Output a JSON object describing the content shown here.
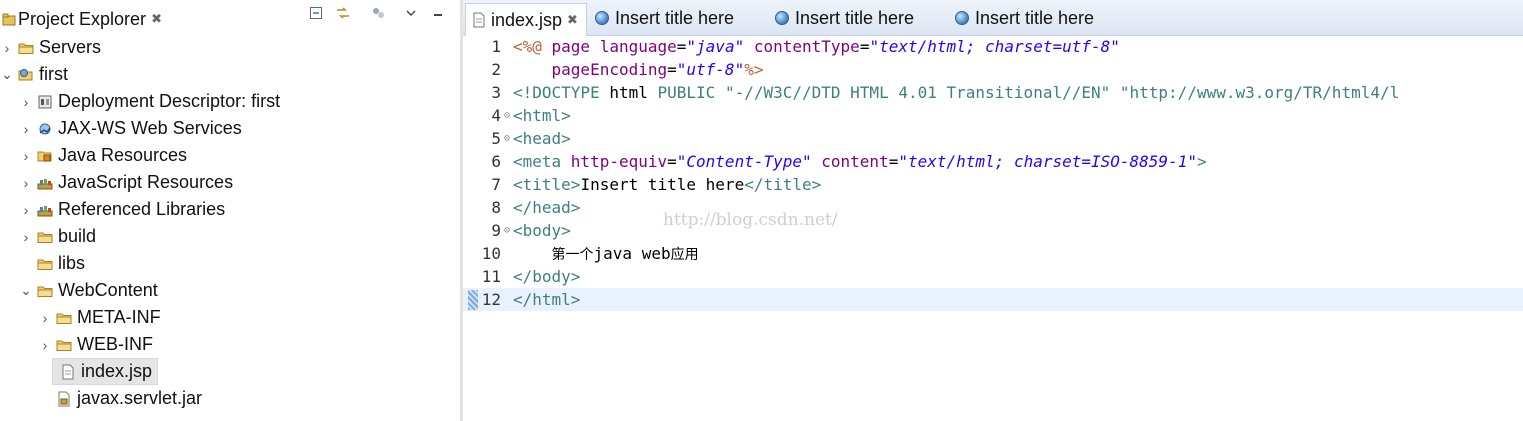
{
  "explorer": {
    "title": "Project Explorer",
    "close": "✖",
    "tree": [
      {
        "label": "Servers",
        "arrow": "›",
        "icon": "folder-icon",
        "indent": 0
      },
      {
        "label": "first",
        "arrow": "⌄",
        "icon": "web-project-icon",
        "indent": 0
      },
      {
        "label": "Deployment Descriptor: first",
        "arrow": "›",
        "icon": "deployment-descriptor-icon",
        "indent": 1
      },
      {
        "label": "JAX-WS Web Services",
        "arrow": "›",
        "icon": "web-services-icon",
        "indent": 1
      },
      {
        "label": "Java Resources",
        "arrow": "›",
        "icon": "java-resources-icon",
        "indent": 1
      },
      {
        "label": "JavaScript Resources",
        "arrow": "›",
        "icon": "library-icon",
        "indent": 1
      },
      {
        "label": "Referenced Libraries",
        "arrow": "›",
        "icon": "library-icon",
        "indent": 1
      },
      {
        "label": "build",
        "arrow": "›",
        "icon": "folder-icon",
        "indent": 1
      },
      {
        "label": "libs",
        "arrow": "",
        "icon": "folder-icon",
        "indent": 1
      },
      {
        "label": "WebContent",
        "arrow": "⌄",
        "icon": "folder-icon",
        "indent": 1
      },
      {
        "label": "META-INF",
        "arrow": "›",
        "icon": "folder-icon",
        "indent": 2
      },
      {
        "label": "WEB-INF",
        "arrow": "›",
        "icon": "folder-icon",
        "indent": 2
      },
      {
        "label": "index.jsp",
        "arrow": "",
        "icon": "jsp-file-icon",
        "indent": 2,
        "selected": true
      },
      {
        "label": "javax.servlet.jar",
        "arrow": "",
        "icon": "jar-file-icon",
        "indent": 2
      }
    ]
  },
  "editor": {
    "tabs": [
      {
        "label": "index.jsp",
        "active": true,
        "close": "✖"
      },
      {
        "label": "Insert title here"
      },
      {
        "label": "Insert title here"
      },
      {
        "label": "Insert title here"
      }
    ],
    "lines": [
      {
        "n": "1",
        "fold": "",
        "tokens": [
          [
            "jsp",
            "<%@ "
          ],
          [
            "attr",
            "page "
          ],
          [
            "attr",
            "language"
          ],
          [
            "plain",
            "="
          ],
          [
            "val",
            "\"java\""
          ],
          [
            "plain",
            " "
          ],
          [
            "attr",
            "contentType"
          ],
          [
            "plain",
            "="
          ],
          [
            "val",
            "\"text/html; charset=utf-8\""
          ]
        ]
      },
      {
        "n": "2",
        "fold": "",
        "tokens": [
          [
            "plain",
            "    "
          ],
          [
            "attr",
            "pageEncoding"
          ],
          [
            "plain",
            "="
          ],
          [
            "val",
            "\"utf-8\""
          ],
          [
            "jsp",
            "%>"
          ]
        ]
      },
      {
        "n": "3",
        "fold": "",
        "tokens": [
          [
            "tag",
            "<!DOCTYPE "
          ],
          [
            "plain",
            "html "
          ],
          [
            "doctype",
            "PUBLIC "
          ],
          [
            "str",
            "\"-//W3C//DTD HTML 4.01 Transitional//EN\" \"http://www.w3.org/TR/html4/l"
          ]
        ]
      },
      {
        "n": "4",
        "fold": "⊝",
        "tokens": [
          [
            "tag",
            "<html>"
          ]
        ]
      },
      {
        "n": "5",
        "fold": "⊝",
        "tokens": [
          [
            "tag",
            "<head>"
          ]
        ]
      },
      {
        "n": "6",
        "fold": "",
        "tokens": [
          [
            "tag",
            "<meta "
          ],
          [
            "attr",
            "http-equiv"
          ],
          [
            "plain",
            "="
          ],
          [
            "val",
            "\"Content-Type\""
          ],
          [
            "plain",
            " "
          ],
          [
            "attr",
            "content"
          ],
          [
            "plain",
            "="
          ],
          [
            "val",
            "\"text/html; charset=ISO-8859-1\""
          ],
          [
            "tag",
            ">"
          ]
        ]
      },
      {
        "n": "7",
        "fold": "",
        "tokens": [
          [
            "tag",
            "<title>"
          ],
          [
            "plain",
            "Insert title here"
          ],
          [
            "tag",
            "</title>"
          ]
        ]
      },
      {
        "n": "8",
        "fold": "",
        "tokens": [
          [
            "tag",
            "</head>"
          ]
        ]
      },
      {
        "n": "9",
        "fold": "⊝",
        "tokens": [
          [
            "tag",
            "<body>"
          ]
        ]
      },
      {
        "n": "10",
        "fold": "",
        "tokens": [
          [
            "plain",
            "    "
          ],
          [
            "cjk",
            "第一个"
          ],
          [
            "plain",
            "java web"
          ],
          [
            "cjk",
            "应用"
          ]
        ]
      },
      {
        "n": "11",
        "fold": "",
        "tokens": [
          [
            "tag",
            "</body>"
          ]
        ]
      },
      {
        "n": "12",
        "fold": "",
        "current": true,
        "tokens": [
          [
            "tag",
            "</html>"
          ]
        ]
      }
    ],
    "watermark": "http://blog.csdn.net/"
  }
}
